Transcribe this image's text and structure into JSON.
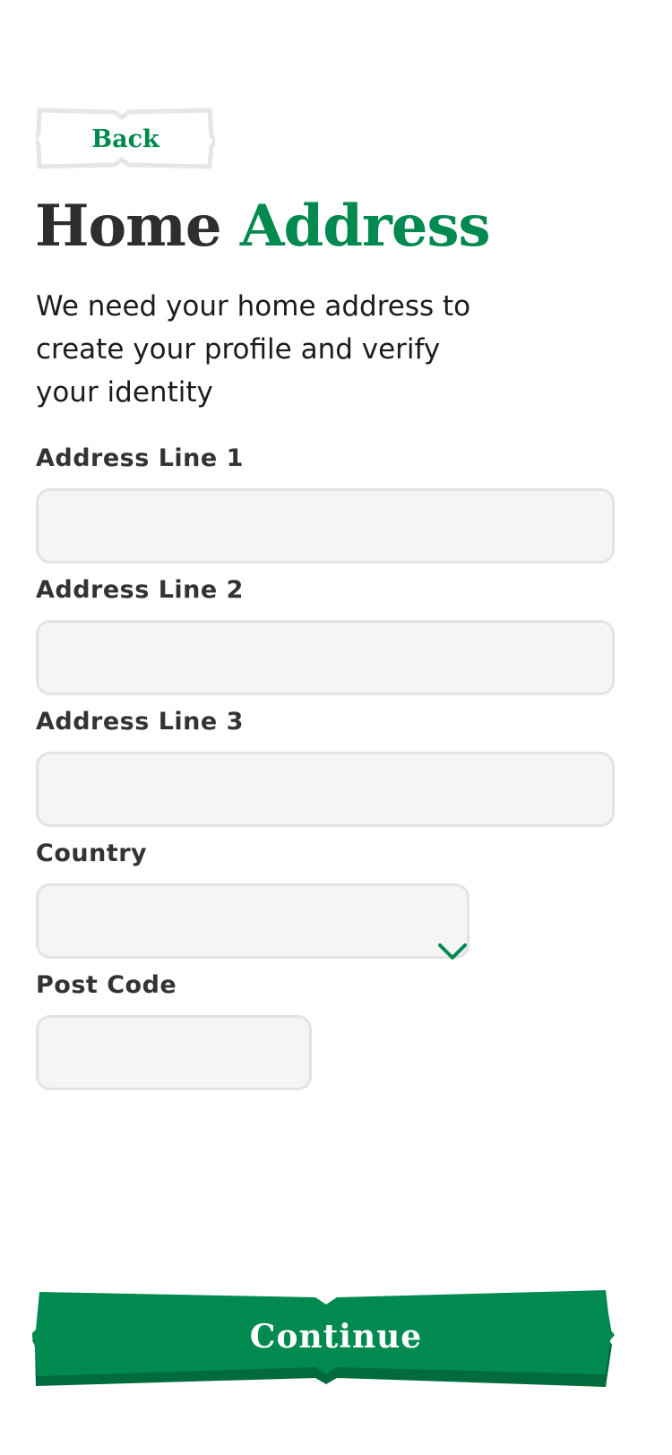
{
  "back": {
    "label": "Back"
  },
  "header": {
    "title_part1": "Home",
    "title_part2": "Address",
    "subtitle": "We need your home address to create your profile and verify your identity"
  },
  "form": {
    "address_line_1": {
      "label": "Address Line 1",
      "value": ""
    },
    "address_line_2": {
      "label": "Address Line 2",
      "value": ""
    },
    "address_line_3": {
      "label": "Address Line 3",
      "value": ""
    },
    "country": {
      "label": "Country",
      "selected": ""
    },
    "post_code": {
      "label": "Post Code",
      "value": ""
    }
  },
  "actions": {
    "continue_label": "Continue"
  },
  "icons": {
    "select_arrow": "chevron-down-icon"
  },
  "colors": {
    "brand_green": "#008a4f",
    "brand_green_dark": "#006b3d",
    "text_dark": "#2e2e2e",
    "field_bg": "#f5f5f5",
    "field_border": "#e3e3e3"
  }
}
